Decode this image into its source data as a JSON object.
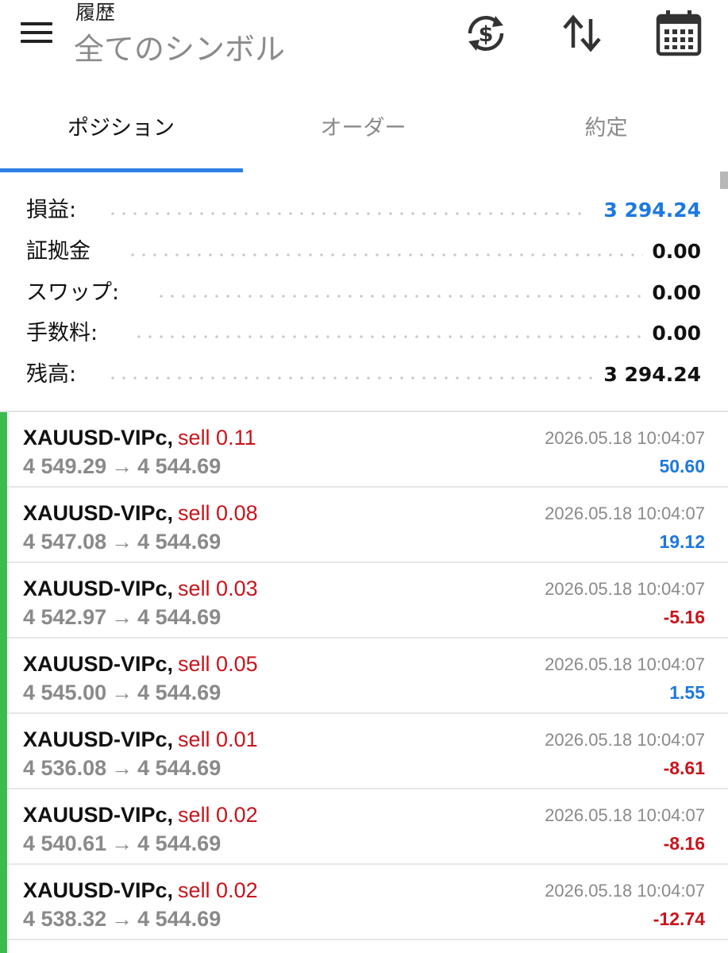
{
  "header": {
    "title": "履歴",
    "subtitle": "全てのシンボル",
    "icons": [
      "menu-icon",
      "currency-exchange-icon",
      "sort-icon",
      "calendar-icon"
    ]
  },
  "tabs": [
    {
      "label": "ポジション",
      "active": true
    },
    {
      "label": "オーダー",
      "active": false
    },
    {
      "label": "約定",
      "active": false
    }
  ],
  "summary": {
    "profit": {
      "label": "損益:",
      "value": "3 294.24"
    },
    "margin": {
      "label": "証拠金",
      "value": "0.00"
    },
    "swap": {
      "label": "スワップ:",
      "value": "0.00"
    },
    "commission": {
      "label": "手数料:",
      "value": "0.00"
    },
    "balance": {
      "label": "残高:",
      "value": "3 294.24"
    }
  },
  "colors": {
    "accent_blue": "#1d78e0",
    "loss_red": "#c8141b",
    "tab_underline": "#2f80e5",
    "position_bar": "#3cbb4f"
  },
  "positions": [
    {
      "symbol": "XAUUSD-VIPc,",
      "side": "sell 0.11",
      "open": "4 549.29",
      "close": "4 544.69",
      "time": "2026.05.18 10:04:07",
      "profit": "50.60",
      "sign": "pos"
    },
    {
      "symbol": "XAUUSD-VIPc,",
      "side": "sell 0.08",
      "open": "4 547.08",
      "close": "4 544.69",
      "time": "2026.05.18 10:04:07",
      "profit": "19.12",
      "sign": "pos"
    },
    {
      "symbol": "XAUUSD-VIPc,",
      "side": "sell 0.03",
      "open": "4 542.97",
      "close": "4 544.69",
      "time": "2026.05.18 10:04:07",
      "profit": "-5.16",
      "sign": "neg"
    },
    {
      "symbol": "XAUUSD-VIPc,",
      "side": "sell 0.05",
      "open": "4 545.00",
      "close": "4 544.69",
      "time": "2026.05.18 10:04:07",
      "profit": "1.55",
      "sign": "pos"
    },
    {
      "symbol": "XAUUSD-VIPc,",
      "side": "sell 0.01",
      "open": "4 536.08",
      "close": "4 544.69",
      "time": "2026.05.18 10:04:07",
      "profit": "-8.61",
      "sign": "neg"
    },
    {
      "symbol": "XAUUSD-VIPc,",
      "side": "sell 0.02",
      "open": "4 540.61",
      "close": "4 544.69",
      "time": "2026.05.18 10:04:07",
      "profit": "-8.16",
      "sign": "neg"
    },
    {
      "symbol": "XAUUSD-VIPc,",
      "side": "sell 0.02",
      "open": "4 538.32",
      "close": "4 544.69",
      "time": "2026.05.18 10:04:07",
      "profit": "-12.74",
      "sign": "neg"
    }
  ]
}
